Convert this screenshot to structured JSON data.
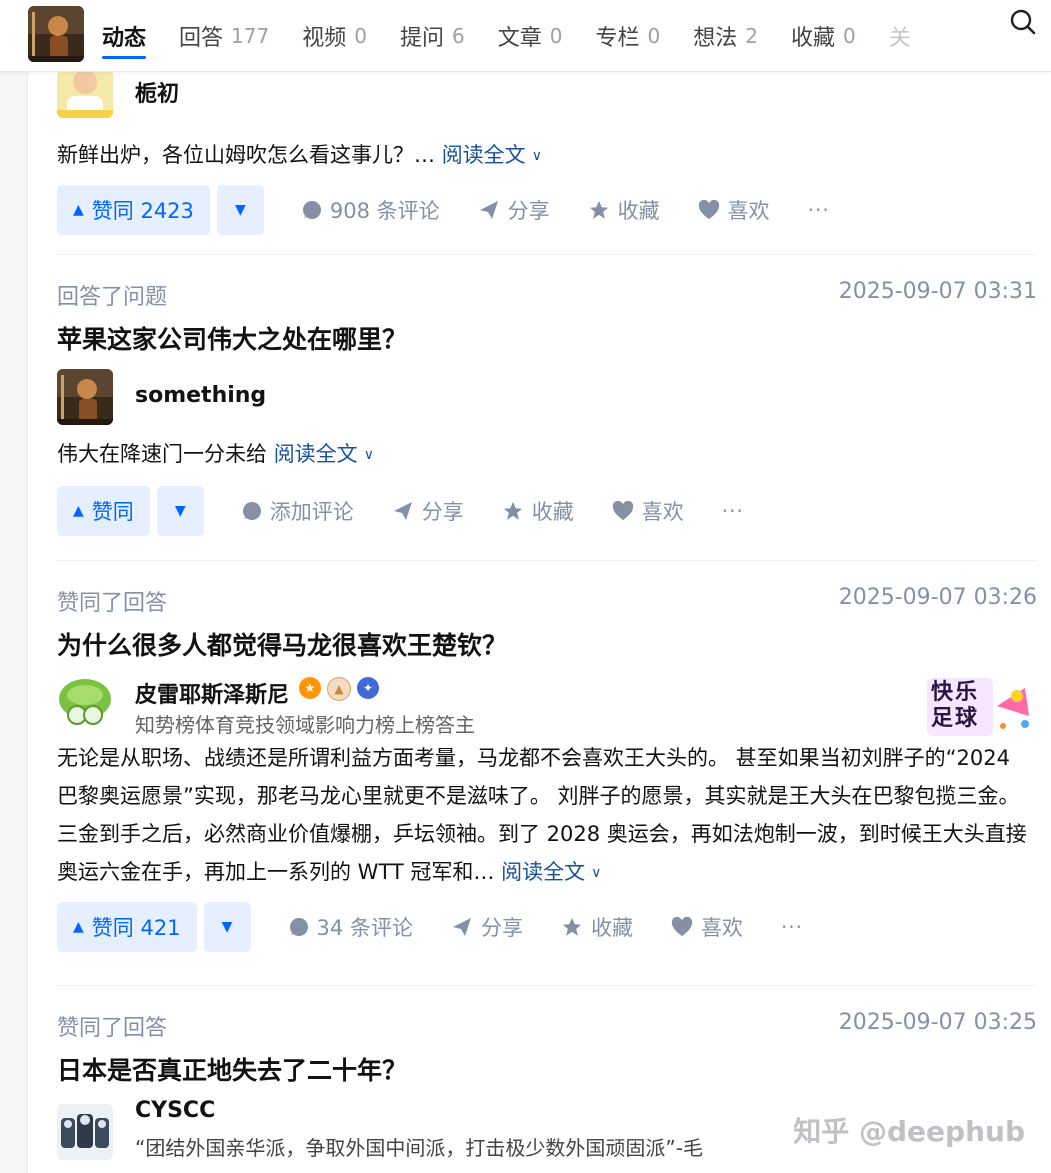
{
  "nav": {
    "tabs": [
      {
        "label": "动态",
        "count": ""
      },
      {
        "label": "回答",
        "count": "177"
      },
      {
        "label": "视频",
        "count": "0"
      },
      {
        "label": "提问",
        "count": "6"
      },
      {
        "label": "文章",
        "count": "0"
      },
      {
        "label": "专栏",
        "count": "0"
      },
      {
        "label": "想法",
        "count": "2"
      },
      {
        "label": "收藏",
        "count": "0"
      },
      {
        "label": "关",
        "count": ""
      }
    ],
    "active_tab": "动态"
  },
  "feed": [
    {
      "author_name": "栀初",
      "excerpt": "新鲜出炉，各位山姆吹怎么看这事儿？…",
      "read_more": "阅读全文",
      "vote_label": "赞同 2423",
      "comment_label": "908 条评论",
      "share_label": "分享",
      "collect_label": "收藏",
      "like_label": "喜欢",
      "more_label": "···"
    },
    {
      "action": "回答了问题",
      "time": "2025-09-07 03:31",
      "question": "苹果这家公司伟大之处在哪里？",
      "author_name": "something",
      "excerpt": "伟大在降速门一分未给",
      "read_more": "阅读全文",
      "vote_label": "赞同",
      "comment_label": "添加评论",
      "share_label": "分享",
      "collect_label": "收藏",
      "like_label": "喜欢",
      "more_label": "···"
    },
    {
      "action": "赞同了回答",
      "time": "2025-09-07 03:26",
      "question": "为什么很多人都觉得马龙很喜欢王楚钦？",
      "author_name": "皮雷耶斯泽斯尼",
      "author_headline": "知势榜体育竞技领域影响力榜上榜答主",
      "promo_text": "快乐足球",
      "excerpt": "无论是从职场、战绩还是所谓利益方面考量，马龙都不会喜欢王大头的。 甚至如果当初刘胖子的“2024 巴黎奥运愿景”实现，那老马龙心里就更不是滋味了。 刘胖子的愿景，其实就是王大头在巴黎包揽三金。三金到手之后，必然商业价值爆棚，乒坛领袖。到了 2028 奥运会，再如法炮制一波，到时候王大头直接奥运六金在手，再加上一系列的 WTT 冠军和…",
      "read_more": "阅读全文",
      "vote_label": "赞同 421",
      "comment_label": "34 条评论",
      "share_label": "分享",
      "collect_label": "收藏",
      "like_label": "喜欢",
      "more_label": "···"
    },
    {
      "action": "赞同了回答",
      "time": "2025-09-07 03:25",
      "question": "日本是否真正地失去了二十年？",
      "author_name": "CYSCC",
      "author_headline": "“团结外国亲华派，争取外国中间派，打击极少数外国顽固派”-毛"
    }
  ],
  "watermark": "知乎 @deephub",
  "colors": {
    "accent": "#0066ff",
    "vote_bg": "#e5efff",
    "meta_gray": "#8590a6",
    "link": "#175199"
  }
}
